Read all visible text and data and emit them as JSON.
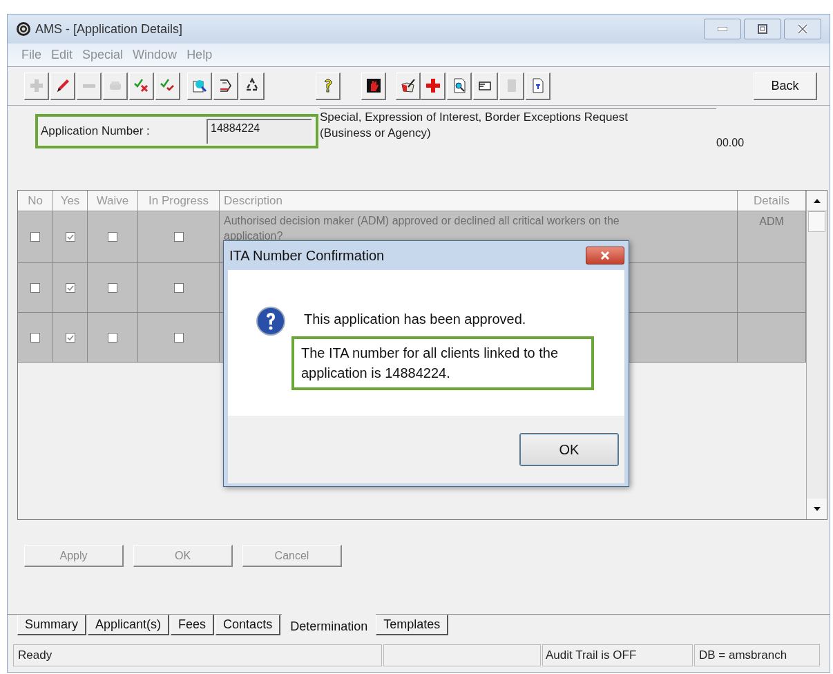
{
  "window": {
    "title": "AMS - [Application Details]"
  },
  "menu": [
    "File",
    "Edit",
    "Special",
    "Window",
    "Help"
  ],
  "toolbar_groups": [
    {
      "buttons": [
        {
          "disabled": true
        },
        {
          "disabled": false
        },
        {
          "disabled": true
        },
        {
          "disabled": true
        },
        {
          "disabled": false
        },
        {
          "disabled": false
        }
      ]
    },
    {
      "buttons": [
        {
          "disabled": false
        },
        {
          "disabled": false
        },
        {
          "disabled": false
        }
      ]
    },
    {
      "buttons": [
        {
          "disabled": false
        }
      ]
    },
    {
      "buttons": [
        {
          "disabled": false
        }
      ]
    },
    {
      "buttons": [
        {
          "disabled": false
        }
      ]
    },
    {
      "buttons": [
        {
          "disabled": false
        },
        {
          "disabled": false
        },
        {
          "disabled": false
        },
        {
          "disabled": true
        },
        {
          "disabled": false
        }
      ]
    }
  ],
  "back_button": "Back",
  "header": {
    "label": "Application Number :",
    "value": "14884224",
    "description": "Special, Expression of Interest, Border Exceptions Request (Business or Agency)",
    "amount": "00.00"
  },
  "table": {
    "columns": [
      "No",
      "Yes",
      "Waive",
      "In Progress",
      "Description",
      "Details"
    ],
    "rows": [
      {
        "no": false,
        "yes": true,
        "waive": false,
        "in_progress": false,
        "description": "Authorised decision maker (ADM) approved or declined all critical workers on the application?",
        "details": "ADM"
      },
      {
        "no": false,
        "yes": true,
        "waive": false,
        "in_progress": false
      },
      {
        "no": false,
        "yes": true,
        "waive": false,
        "in_progress": false
      }
    ]
  },
  "actions": [
    {
      "label": "Apply",
      "disabled": true
    },
    {
      "label": "OK",
      "disabled": true
    },
    {
      "label": "Cancel",
      "disabled": true
    }
  ],
  "tabs": [
    {
      "label": "Summary",
      "selected": false
    },
    {
      "label": "Applicant(s)",
      "selected": false
    },
    {
      "label": "Fees",
      "selected": false
    },
    {
      "label": "Contacts",
      "selected": false
    },
    {
      "label": "Determination",
      "selected": true
    },
    {
      "label": "Templates",
      "selected": false
    }
  ],
  "status_bar": {
    "message": "Ready",
    "audit": "Audit Trail is OFF",
    "database": "DB = amsbranch"
  },
  "dialog": {
    "title": "ITA Number Confirmation",
    "message": "This application has been approved.",
    "highlight": "The ITA number for all clients linked to the application is 14884224.",
    "button": "OK"
  }
}
